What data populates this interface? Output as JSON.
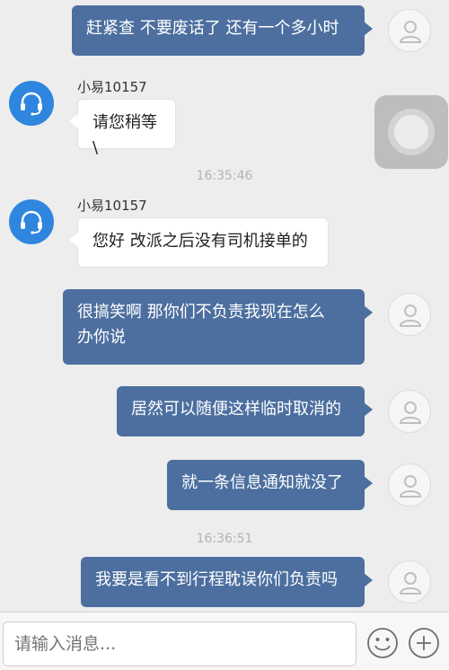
{
  "messages": [
    {
      "side": "out",
      "text": "赶紧查 不要废话了 还有一个多小时"
    },
    {
      "side": "in",
      "sender": "小易10157",
      "text": "请您稍等\\"
    },
    {
      "timestamp": "16:35:46"
    },
    {
      "side": "in",
      "sender": "小易10157",
      "text": "您好 改派之后没有司机接单的"
    },
    {
      "side": "out",
      "text_lines": [
        "很搞笑啊 那你们不负责我现在怎么",
        "办你说"
      ]
    },
    {
      "side": "out",
      "text": "居然可以随便这样临时取消的"
    },
    {
      "side": "out",
      "text": "就一条信息通知就没了"
    },
    {
      "timestamp": "16:36:51"
    },
    {
      "side": "out",
      "text": "我要是看不到行程耽误你们负责吗"
    }
  ],
  "input": {
    "placeholder": "请输入消息..."
  },
  "icons": {
    "user_avatar": "user-icon",
    "agent_avatar": "headset-icon",
    "emoji": "smiley-icon",
    "add": "plus-icon",
    "floating": "assistive-touch-icon"
  },
  "colors": {
    "outgoing_bubble": "#4c6f9f",
    "agent_avatar": "#2f86de",
    "background": "#ededed"
  }
}
